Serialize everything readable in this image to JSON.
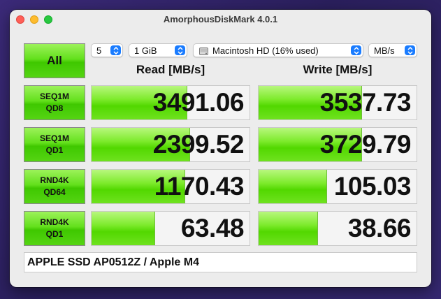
{
  "window": {
    "title": "AmorphousDiskMark 4.0.1"
  },
  "controls": {
    "all_label": "All",
    "count": "5",
    "size": "1 GiB",
    "drive": "Macintosh HD (16% used)",
    "unit": "MB/s"
  },
  "headers": {
    "read": "Read [MB/s]",
    "write": "Write [MB/s]"
  },
  "tests": [
    {
      "line1": "SEQ1M",
      "line2": "QD8",
      "read": "3491.06",
      "write": "3537.73",
      "read_fill": 0.6,
      "write_fill": 0.65
    },
    {
      "line1": "SEQ1M",
      "line2": "QD1",
      "read": "2399.52",
      "write": "3729.79",
      "read_fill": 0.62,
      "write_fill": 0.65
    },
    {
      "line1": "RND4K",
      "line2": "QD64",
      "read": "1170.43",
      "write": "105.03",
      "read_fill": 0.59,
      "write_fill": 0.43
    },
    {
      "line1": "RND4K",
      "line2": "QD1",
      "read": "63.48",
      "write": "38.66",
      "read_fill": 0.4,
      "write_fill": 0.37
    }
  ],
  "comment": "APPLE SSD AP0512Z / Apple M4",
  "colors": {
    "accent_green": "#52d800",
    "stepper_blue": "#1a7cff"
  }
}
